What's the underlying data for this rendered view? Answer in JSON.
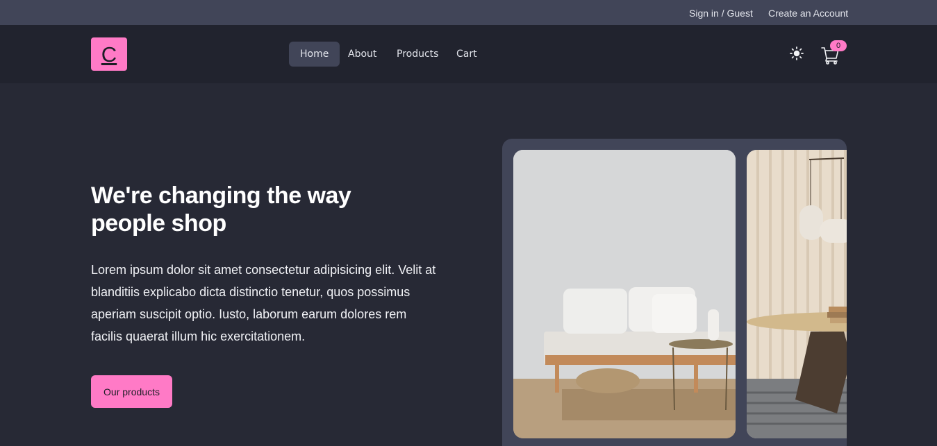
{
  "topbar": {
    "signin": "Sign in / Guest",
    "create_account": "Create an Account"
  },
  "logo": {
    "letter": "C"
  },
  "nav": {
    "items": [
      "Home",
      "About",
      "Products",
      "Cart"
    ],
    "active": "Home"
  },
  "cart": {
    "count": "0"
  },
  "hero": {
    "title": "We're changing the way people shop",
    "text": "Lorem ipsum dolor sit amet consectetur adipisicing elit. Velit at blanditiis explicabo dicta distinctio tenetur, quos possimus aperiam suscipit optio. Iusto, laborum earum dolores rem facilis quaerat illum hic exercitationem.",
    "cta": "Our products"
  },
  "colors": {
    "accent": "#ff7ac6",
    "background": "#272935",
    "navbar": "#21232e",
    "topbar": "#414558"
  },
  "icons": {
    "theme": "sun-icon",
    "cart": "cart-icon"
  }
}
